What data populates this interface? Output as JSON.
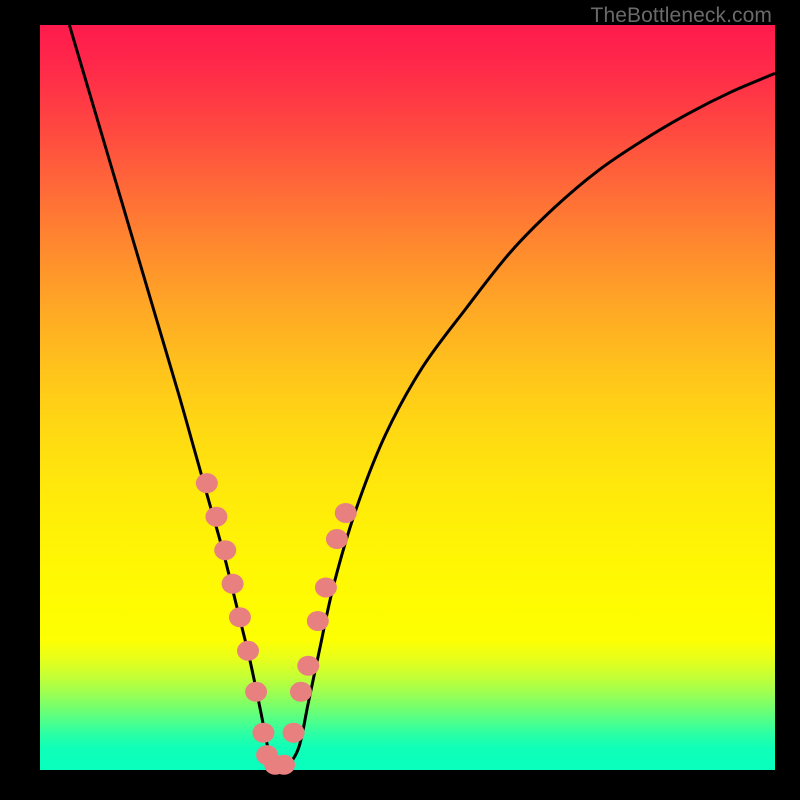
{
  "watermark": "TheBottleneck.com",
  "chart_data": {
    "type": "line",
    "title": "",
    "xlabel": "",
    "ylabel": "",
    "xlim": [
      0,
      100
    ],
    "ylim": [
      0,
      100
    ],
    "grid": false,
    "series": [
      {
        "name": "curve",
        "color": "#000000",
        "x": [
          4,
          7,
          10,
          13,
          16,
          19,
          21,
          23,
          25,
          27,
          28.5,
          30,
          31,
          31.8,
          33.5,
          35.2,
          36.5,
          38,
          40,
          43,
          47,
          52,
          58,
          64,
          70,
          76,
          82,
          88,
          94,
          100
        ],
        "y": [
          100,
          90,
          80,
          70,
          60,
          50,
          43,
          36,
          29,
          21,
          15,
          8,
          3,
          0.5,
          0.5,
          3,
          9,
          16,
          25,
          35,
          45,
          54,
          62,
          69.5,
          75.5,
          80.5,
          84.5,
          88,
          91,
          93.5
        ]
      },
      {
        "name": "dots",
        "color": "#e88080",
        "type": "scatter",
        "x": [
          22.7,
          24.0,
          25.2,
          26.2,
          27.2,
          28.3,
          29.4,
          30.4,
          30.9,
          32.0,
          33.2,
          34.5,
          35.5,
          36.5,
          37.8,
          38.9,
          40.4,
          41.6
        ],
        "y": [
          38.5,
          34.0,
          29.5,
          25.0,
          20.5,
          16.0,
          10.5,
          5.0,
          2.0,
          0.7,
          0.7,
          5.0,
          10.5,
          14.0,
          20.0,
          24.5,
          31.0,
          34.5
        ]
      }
    ]
  }
}
